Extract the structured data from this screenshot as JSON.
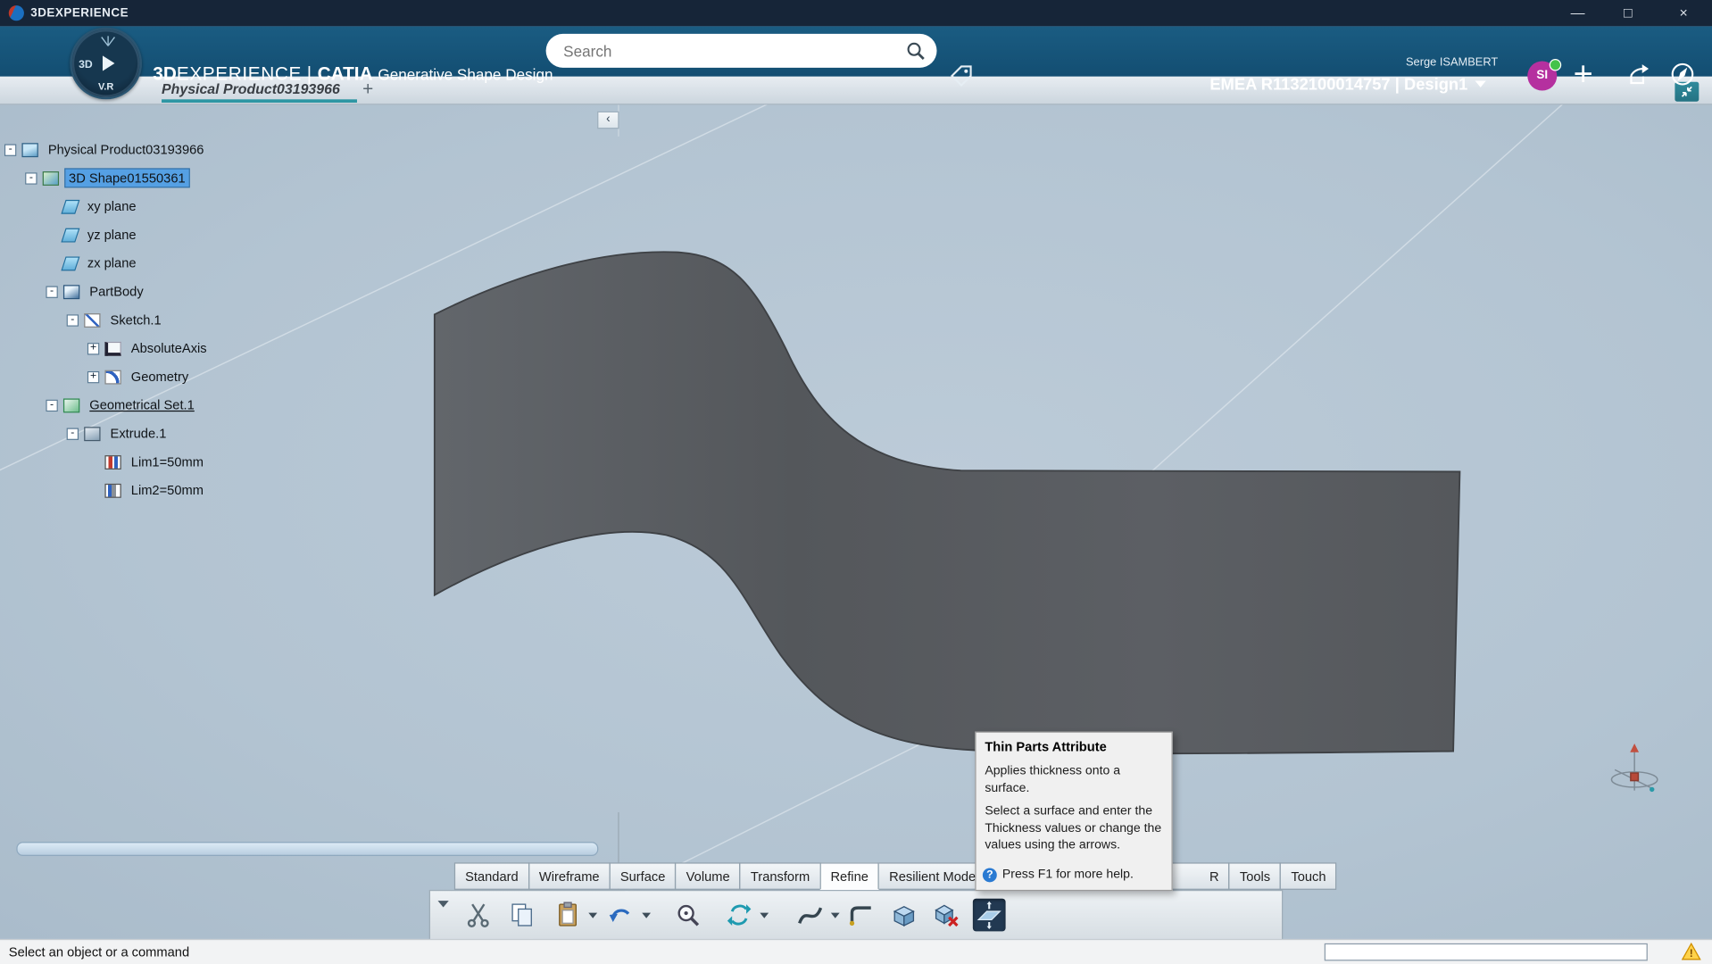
{
  "titlebar": {
    "title": "3DEXPERIENCE",
    "controls": {
      "minimize": "—",
      "maximize": "□",
      "close": "×"
    }
  },
  "header": {
    "brand_bold": "3D",
    "brand_light": "EXPERIENCE",
    "divider": "|",
    "app": "CATIA",
    "module": "Generative Shape Design",
    "search_placeholder": "Search",
    "user_name": "Serge ISAMBERT",
    "tenant": "EMEA R1132100014757 | Design1",
    "avatar_initials": "SI",
    "add_glyph": "+"
  },
  "compass": {
    "label_3d": "3D",
    "label_vr": "V.R"
  },
  "tabbar": {
    "document_tab": "Physical Product03193966",
    "new_tab": "+"
  },
  "tree": {
    "items": [
      {
        "label": "Physical Product03193966",
        "depth": 0,
        "icon": "product",
        "expander": "open"
      },
      {
        "label": "3D Shape01550361",
        "depth": 1,
        "icon": "shape3d",
        "expander": "open",
        "selected": true
      },
      {
        "label": "xy plane",
        "depth": 2,
        "icon": "plane",
        "expander": "leaf"
      },
      {
        "label": "yz plane",
        "depth": 2,
        "icon": "plane",
        "expander": "leaf"
      },
      {
        "label": "zx plane",
        "depth": 2,
        "icon": "plane",
        "expander": "leaf"
      },
      {
        "label": "PartBody",
        "depth": 2,
        "icon": "partbody",
        "expander": "open"
      },
      {
        "label": "Sketch.1",
        "depth": 3,
        "icon": "sketch",
        "expander": "open"
      },
      {
        "label": "AbsoluteAxis",
        "depth": 4,
        "icon": "axis",
        "expander": "closed"
      },
      {
        "label": "Geometry",
        "depth": 4,
        "icon": "geometry",
        "expander": "closed"
      },
      {
        "label": "Geometrical Set.1",
        "depth": 2,
        "icon": "geoset",
        "expander": "open",
        "underline": true
      },
      {
        "label": "Extrude.1",
        "depth": 3,
        "icon": "extrude",
        "expander": "open"
      },
      {
        "label": "Lim1=50mm",
        "depth": 4,
        "icon": "limit1",
        "expander": "leaf"
      },
      {
        "label": "Lim2=50mm",
        "depth": 4,
        "icon": "limit2",
        "expander": "leaf"
      }
    ]
  },
  "tooltip": {
    "title": "Thin Parts Attribute",
    "body1": "Applies thickness onto a surface.",
    "body2": "Select a surface and enter the Thickness values or change the values using the arrows.",
    "help_text": "Press F1 for more help."
  },
  "ribbon_tabs": [
    {
      "label": "Standard"
    },
    {
      "label": "Wireframe"
    },
    {
      "label": "Surface"
    },
    {
      "label": "Volume"
    },
    {
      "label": "Transform"
    },
    {
      "label": "Refine",
      "active": true
    },
    {
      "label": "Resilient Modeling"
    },
    {
      "label": "R",
      "partial": true
    },
    {
      "label": "Tools"
    },
    {
      "label": "Touch"
    }
  ],
  "toolbar_buttons": [
    {
      "name": "cut-button",
      "icon": "scissors-icon"
    },
    {
      "name": "copy-button",
      "icon": "copy-icon"
    },
    {
      "name": "paste-button",
      "icon": "paste-icon",
      "dropdown": true
    },
    {
      "name": "undo-button",
      "icon": "undo-icon",
      "dropdown": true
    },
    {
      "name": "zoom-button",
      "icon": "zoom-icon"
    },
    {
      "name": "update-button",
      "icon": "update-icon",
      "dropdown": true
    },
    {
      "name": "sweep-button",
      "icon": "sweep-icon",
      "dropdown": true
    },
    {
      "name": "extract-button",
      "icon": "corner-icon"
    },
    {
      "name": "volume-button",
      "icon": "volume-icon"
    },
    {
      "name": "volume-delete-button",
      "icon": "volume-delete-icon"
    },
    {
      "name": "thin-parts-attribute-button",
      "icon": "thin-parts-icon",
      "pressed": true
    }
  ],
  "statusbar": {
    "message": "Select an object or a command",
    "command_value": ""
  },
  "misc": {
    "collapse_glyph": "‹"
  },
  "colors": {
    "titlebar": "#162538",
    "header": "#17547a",
    "tab_underline": "#2d96a3",
    "selection": "#55a0e4",
    "avatar": "#b5309f",
    "surface": "#5a5e62",
    "viewport_bg": "#b6c7d5",
    "warning": "#ffd24a"
  }
}
